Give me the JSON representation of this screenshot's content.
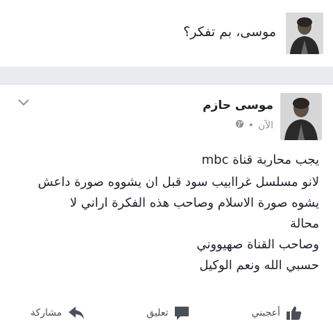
{
  "composer": {
    "prompt": "موسى، بم تفكر؟",
    "avatar_icon": "profile-photo"
  },
  "post": {
    "author": "موسى حازم",
    "timestamp": "الآن",
    "separator": "•",
    "privacy_icon": "globe-icon",
    "menu_icon": "chevron-down-icon",
    "lines": [
      "يجب محاربة قناة mbc",
      "لانو مسلسل غراابيب سود قبل ان يشووه صورة داعش",
      "يشوه صورة الاسلام وصاحب هذه الفكرة اراني لا",
      "محالة",
      "وصاحب القناة صهيووني",
      "حسبي الله ونعم الوكيل"
    ]
  },
  "actions": {
    "like": "أعجبني",
    "comment": "تعليق",
    "share": "مشاركة"
  },
  "colors": {
    "text": "#1d2129",
    "meta": "#90949c",
    "action": "#4b4f56",
    "divider_bg": "#e9ebee"
  }
}
